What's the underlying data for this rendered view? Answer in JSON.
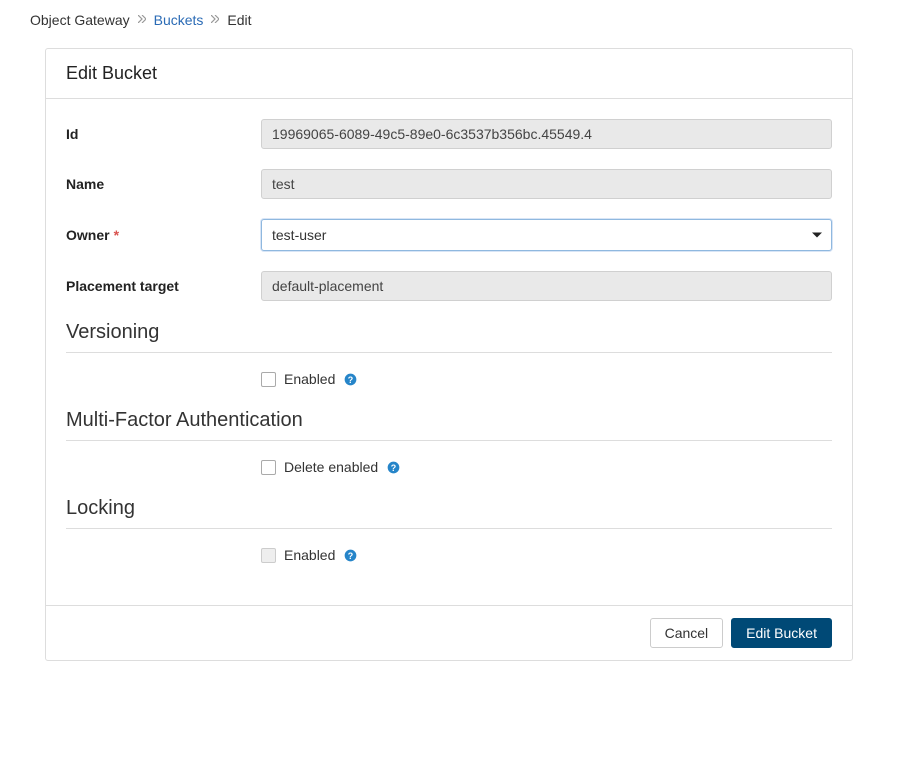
{
  "breadcrumb": {
    "item0": "Object Gateway",
    "item1": "Buckets",
    "item2": "Edit"
  },
  "panel": {
    "title": "Edit Bucket"
  },
  "form": {
    "id_label": "Id",
    "id_value": "19969065-6089-49c5-89e0-6c3537b356bc.45549.4",
    "name_label": "Name",
    "name_value": "test",
    "owner_label": "Owner",
    "owner_value": "test-user",
    "placement_label": "Placement target",
    "placement_value": "default-placement"
  },
  "sections": {
    "versioning_title": "Versioning",
    "versioning_enabled_label": "Enabled",
    "mfa_title": "Multi-Factor Authentication",
    "mfa_delete_label": "Delete enabled",
    "locking_title": "Locking",
    "locking_enabled_label": "Enabled"
  },
  "actions": {
    "cancel": "Cancel",
    "submit": "Edit Bucket"
  }
}
